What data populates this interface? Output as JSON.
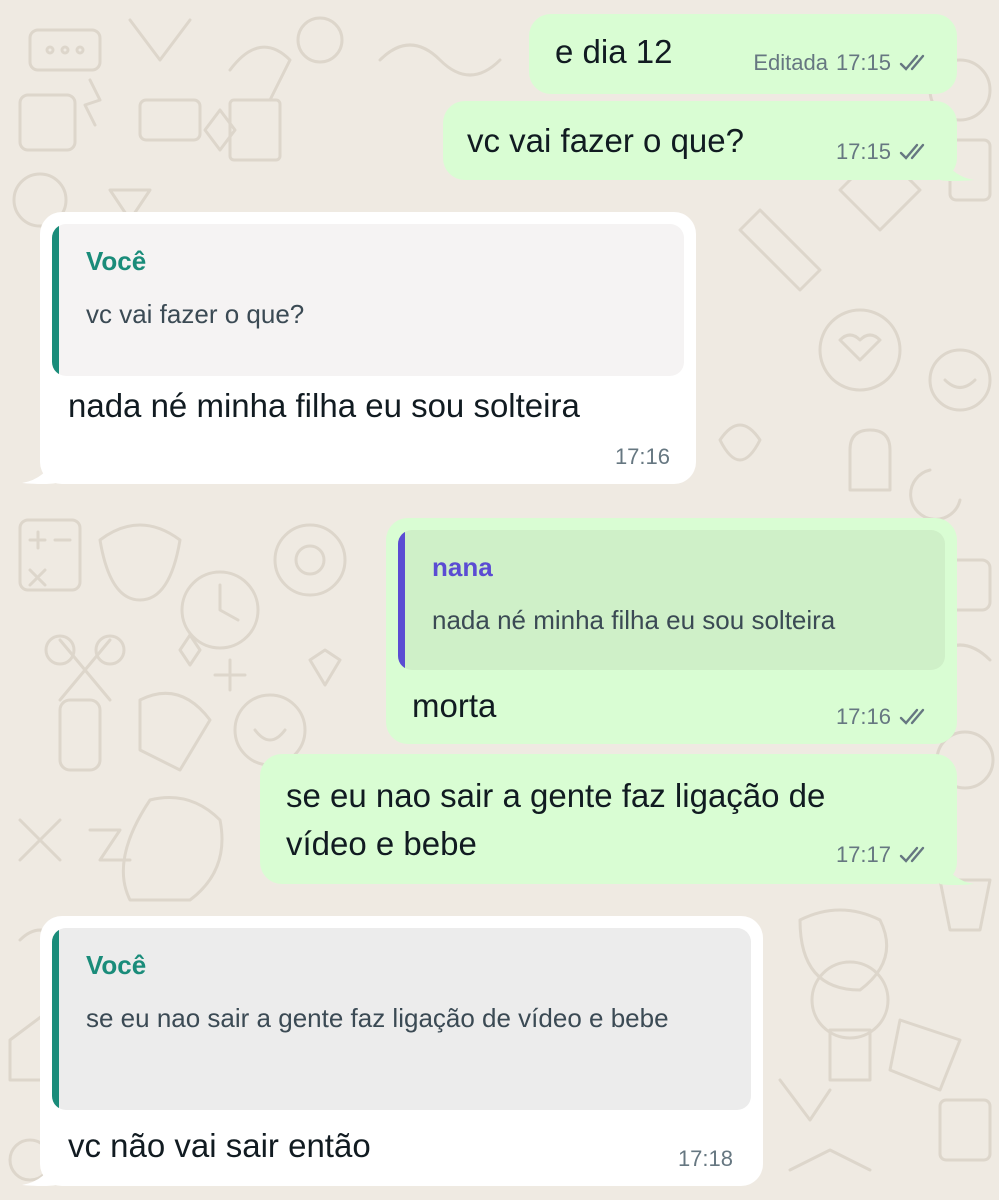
{
  "colors": {
    "outgoing_bubble": "#d9fdd3",
    "incoming_bubble": "#ffffff",
    "quote_author_you": "#1a8c7a",
    "quote_author_nana": "#5b4cd3",
    "chat_background": "#efeae2"
  },
  "messages": [
    {
      "text": "e dia 12",
      "edited_label": "Editada",
      "time": "17:15",
      "status_icon": "double-check-icon"
    },
    {
      "text": "vc vai fazer o que?",
      "time": "17:15",
      "status_icon": "double-check-icon"
    },
    {
      "quote": {
        "author": "Você",
        "text": "vc vai fazer o que?"
      },
      "text": "nada né minha filha eu sou solteira",
      "time": "17:16"
    },
    {
      "quote": {
        "author": "nana",
        "text": "nada né minha filha eu sou solteira"
      },
      "text": "morta",
      "time": "17:16",
      "status_icon": "double-check-icon"
    },
    {
      "text_line1": "se eu nao sair a gente faz ligação de",
      "text_line2": "vídeo e bebe",
      "time": "17:17",
      "status_icon": "double-check-icon"
    },
    {
      "quote": {
        "author": "Você",
        "text": "se eu nao sair a gente faz ligação de vídeo e bebe"
      },
      "text": "vc não vai sair então",
      "time": "17:18"
    }
  ]
}
